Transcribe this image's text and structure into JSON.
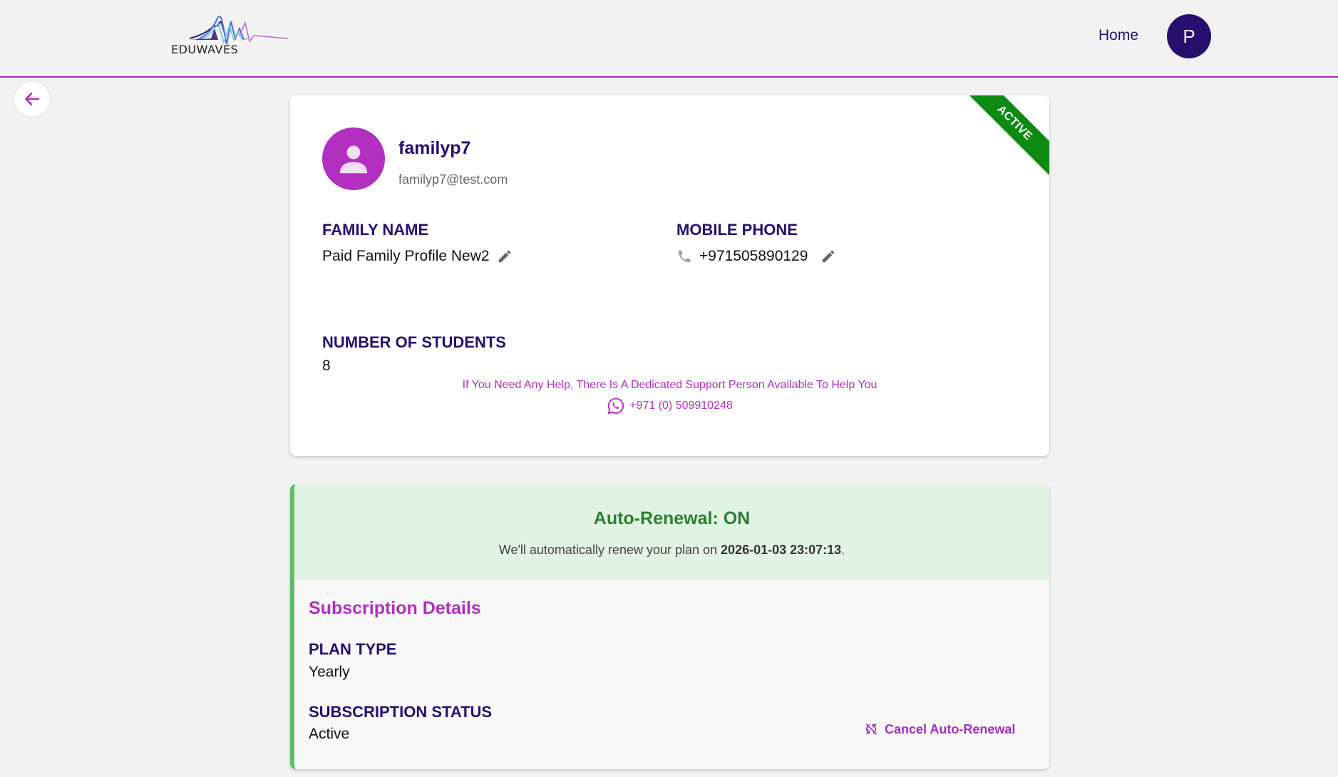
{
  "header": {
    "logo_text": "EDUWAVES",
    "nav_home": "Home",
    "avatar_initial": "P"
  },
  "profile": {
    "status_ribbon": "ACTIVE",
    "username": "familyp7",
    "email": "familyp7@test.com",
    "family_name_label": "FAMILY NAME",
    "family_name_value": "Paid Family Profile New2",
    "mobile_label": "MOBILE PHONE",
    "mobile_value": "+971505890129",
    "students_label": "NUMBER OF STUDENTS",
    "students_value": "8",
    "help_text": "If You Need Any Help, There Is A Dedicated Support Person Available To Help You",
    "help_phone": "+971 (0) 509910248"
  },
  "subscription": {
    "renew_title": "Auto-Renewal: ON",
    "renew_text_prefix": "We'll automatically renew your plan on ",
    "renew_date": "2026-01-03 23:07:13",
    "renew_text_suffix": ".",
    "section_title": "Subscription Details",
    "plan_type_label": "PLAN TYPE",
    "plan_type_value": "Yearly",
    "status_label": "SUBSCRIPTION STATUS",
    "status_value": "Active",
    "cancel_label": "Cancel Auto-Renewal"
  },
  "colors": {
    "brand_navy": "#25106e",
    "brand_purple": "#b22fbf",
    "active_green": "#0c8a12",
    "renew_green": "#2e7d32"
  }
}
